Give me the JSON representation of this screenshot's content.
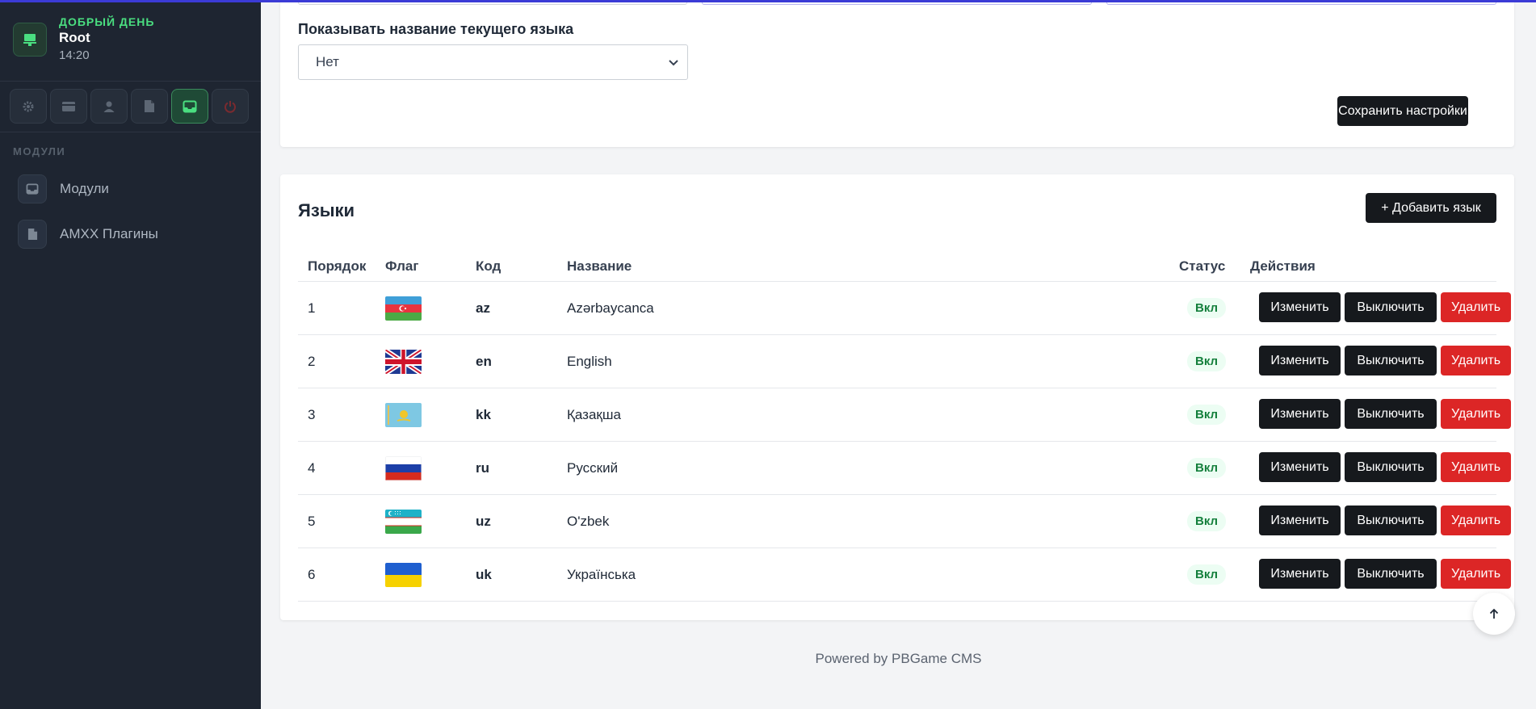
{
  "sidebar": {
    "user": {
      "greeting": "ДОБРЫЙ ДЕНЬ",
      "name": "Root",
      "time": "14:20"
    },
    "quick_icons": [
      "gear-icon",
      "card-icon",
      "user-icon",
      "file-icon",
      "inbox-icon",
      "power-icon"
    ],
    "section_title": "МОДУЛИ",
    "items": [
      {
        "label": "Модули",
        "icon": "inbox-icon"
      },
      {
        "label": "AMXX Плагины",
        "icon": "file-icon"
      }
    ]
  },
  "settings": {
    "show_lang_label": "Показывать название текущего языка",
    "show_lang_value": "Нет",
    "save_label": "Сохранить настройки"
  },
  "languages": {
    "title": "Языки",
    "add_label": "+ Добавить язык",
    "columns": {
      "order": "Порядок",
      "flag": "Флаг",
      "code": "Код",
      "name": "Название",
      "status": "Статус",
      "actions": "Действия"
    },
    "rows": [
      {
        "order": "1",
        "code": "az",
        "name": "Azərbaycanca",
        "status": "Вкл"
      },
      {
        "order": "2",
        "code": "en",
        "name": "English",
        "status": "Вкл"
      },
      {
        "order": "3",
        "code": "kk",
        "name": "Қазақша",
        "status": "Вкл"
      },
      {
        "order": "4",
        "code": "ru",
        "name": "Русский",
        "status": "Вкл"
      },
      {
        "order": "5",
        "code": "uz",
        "name": "O'zbek",
        "status": "Вкл"
      },
      {
        "order": "6",
        "code": "uk",
        "name": "Українська",
        "status": "Вкл"
      }
    ],
    "actions": {
      "edit": "Изменить",
      "disable": "Выключить",
      "delete": "Удалить"
    }
  },
  "footer": {
    "text": "Powered by PBGame CMS"
  },
  "colors": {
    "accent": "#4ade80",
    "sidebar_bg": "#1e2531",
    "danger": "#dc2626",
    "dark_button": "#16191d",
    "status_on": "#15803d"
  }
}
